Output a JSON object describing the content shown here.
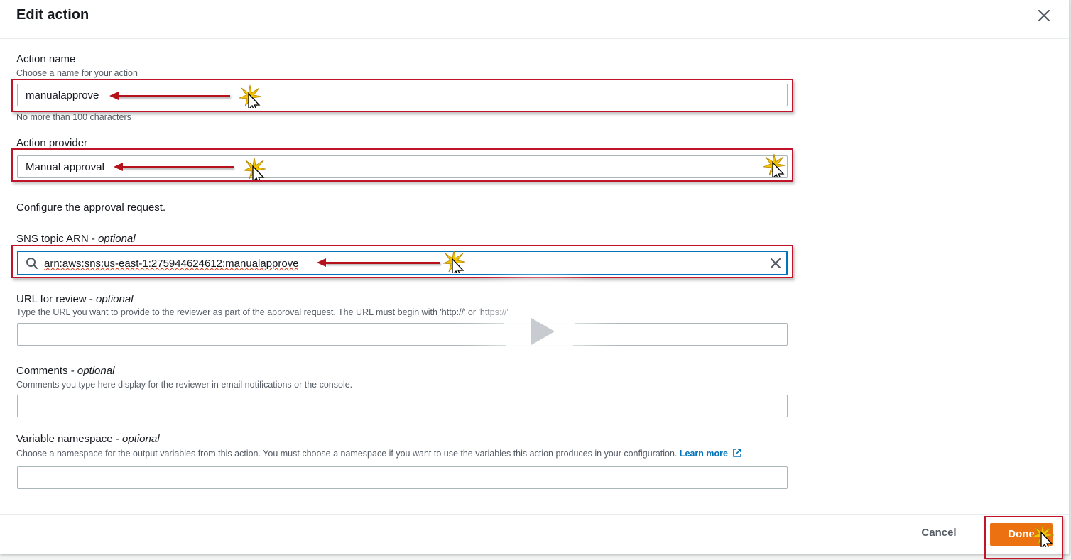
{
  "modal": {
    "title": "Edit action",
    "close_icon": "close-icon"
  },
  "action_name": {
    "label": "Action name",
    "description": "Choose a name for your action",
    "value": "manualapprove",
    "constraint": "No more than 100 characters"
  },
  "action_provider": {
    "label": "Action provider",
    "value": "Manual approval"
  },
  "approval_section": {
    "text": "Configure the approval request."
  },
  "sns_topic": {
    "label": "SNS topic ARN",
    "optional": "optional",
    "value": "arn:aws:sns:us-east-1:275944624612:manualapprove",
    "search_icon": "search-icon",
    "clear_icon": "clear-icon"
  },
  "review_url": {
    "label": "URL for review",
    "optional": "optional",
    "description": "Type the URL you want to provide to the reviewer as part of the approval request. The URL must begin with 'http://' or 'https://'.",
    "value": ""
  },
  "comments": {
    "label": "Comments",
    "optional": "optional",
    "description": "Comments you type here display for the reviewer in email notifications or the console.",
    "value": ""
  },
  "variable_namespace": {
    "label": "Variable namespace",
    "optional": "optional",
    "description": "Choose a namespace for the output variables from this action. You must choose a namespace if you want to use the variables this action produces in your configuration.",
    "learn_more": "Learn more",
    "external_icon": "external-link-icon",
    "value": ""
  },
  "footer": {
    "cancel_label": "Cancel",
    "done_label": "Done"
  },
  "overlay": {
    "play_icon": "play-icon",
    "annotation_color": "#c0142b",
    "primary_color": "#ec7211",
    "link_color": "#0073bb"
  }
}
